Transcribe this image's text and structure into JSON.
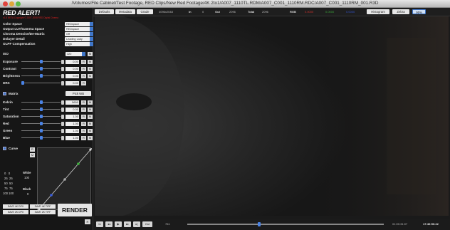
{
  "window": {
    "title": "/Volumes/File Cabinet/Test Footage, RED Clips/New Red Footage/4K 2to1/A007_1110TL.RDM/A007_C001_1110RM.RDC/A007_C001_1110RM_001.R3D",
    "controls": [
      "close",
      "minimize",
      "zoom"
    ]
  },
  "app": {
    "logo": "RED ALERT!",
    "subtitle": "v1.8 BETA Copyright © 2007-2008 RED Digital Cinema"
  },
  "settings": [
    {
      "label": "Color Space",
      "value": "REDspace"
    },
    {
      "label": "Output LUT/Gamma Space",
      "value": "REDspace"
    },
    {
      "label": "Chroma Denoise/De-Matrix",
      "value": "Off"
    },
    {
      "label": "Dolayer Detail",
      "value": "Leading Lady"
    },
    {
      "label": "OLPF Compensation",
      "value": "High"
    }
  ],
  "iso": {
    "label": "ISO",
    "value": "320",
    "m_label": "M"
  },
  "adjustments": [
    {
      "label": "Exposure",
      "value": "0.00",
      "r": "R",
      "m": "M"
    },
    {
      "label": "Contrast",
      "value": "0.00",
      "r": "R",
      "m": "M"
    },
    {
      "label": "Brightness",
      "value": "0.00",
      "r": "R",
      "m": "M"
    },
    {
      "label": "DRX",
      "value": "0.00",
      "r": "R"
    }
  ],
  "matrix": {
    "title": "Matrix",
    "pick_wb": "Pick WB",
    "rows": [
      {
        "label": "Kelvin",
        "value": "5600",
        "r": "R",
        "m": "M"
      },
      {
        "label": "Tint",
        "value": "0.00",
        "r": "R",
        "m": "M"
      },
      {
        "label": "Saturation",
        "value": "1.00",
        "r": "R",
        "m": "M"
      },
      {
        "label": "Red",
        "value": "1.00",
        "r": "R",
        "m": "M"
      },
      {
        "label": "Green",
        "value": "1.00",
        "r": "R",
        "m": "M"
      },
      {
        "label": "Blue",
        "value": "1.00",
        "r": "R",
        "m": "M"
      }
    ]
  },
  "curve": {
    "title": "Curve",
    "buttons": [
      "R",
      "M"
    ],
    "levels_left": [
      [
        "0",
        "0"
      ],
      [
        "25",
        "25"
      ],
      [
        "50",
        "50"
      ],
      [
        "75",
        "75"
      ],
      [
        "100",
        "100"
      ]
    ],
    "white_label": "White",
    "white_value": "100",
    "black_label": "Black",
    "black_value": "0"
  },
  "save_buttons": [
    "SAVE 4K DPX",
    "SAVE 4K TIFF",
    "SAVE 2K DPX",
    "SAVE 2K TIFF"
  ],
  "render_label": "RENDER",
  "toolbar": {
    "defaults": "Defaults",
    "metadata": "Metadata",
    "grade": "Grade",
    "resolution": "4096x2048",
    "in_label": "In",
    "in_value": "0",
    "out_label": "Out",
    "out_value": "2096",
    "total_label": "Total",
    "total_value": "2096",
    "rgb_label": "RGB",
    "rgb_r": "0.0000",
    "rgb_g": "0.0000",
    "rgb_b": "0.0000",
    "histogram": "Histogram",
    "zebra": "Zebra",
    "zoom": "95%"
  },
  "playback": {
    "in_button": "In",
    "out_button": "Out",
    "frame": "761",
    "timecode_1": "01:00:31:07",
    "timecode_2": "17:40:50:22",
    "progress": 0.36,
    "corner_r": "R"
  },
  "colors": {
    "accent_blue": "#3f76c9",
    "logo_red": "#d62020",
    "rgb_red": "#c9302c",
    "rgb_green": "#3aa33a",
    "rgb_blue": "#3353c9"
  }
}
